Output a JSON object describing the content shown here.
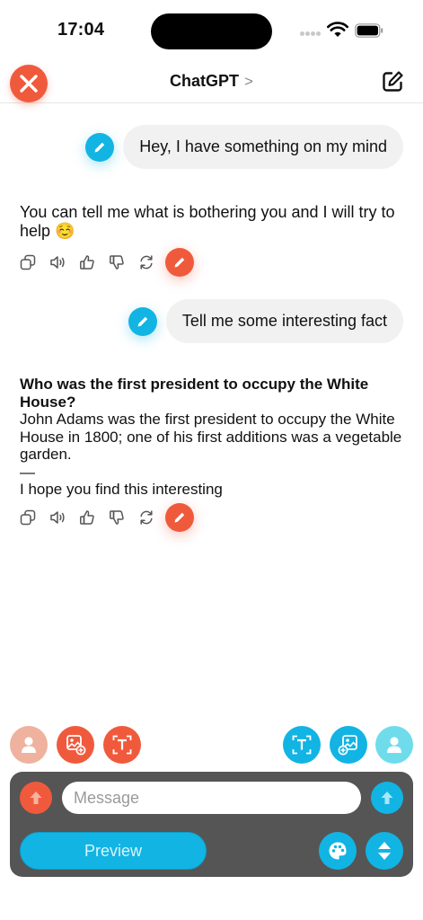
{
  "status_bar": {
    "time": "17:04"
  },
  "header": {
    "title": "ChatGPT",
    "chevron": ">"
  },
  "conversation": [
    {
      "role": "user",
      "text": "Hey, I have something on my mind"
    },
    {
      "role": "assistant",
      "text": "You can tell me what is bothering you and I will try to help ☺️"
    },
    {
      "role": "user",
      "text": "Tell me some interesting fact"
    },
    {
      "role": "assistant",
      "question": "Who was the first president to occupy the White House?",
      "answer": "John Adams was the first president to occupy the White House in 1800; one of his first additions was a vegetable garden.",
      "separator": "—",
      "closing": "I hope you find this interesting"
    }
  ],
  "message_actions": [
    "copy-icon",
    "speaker-icon",
    "thumbs-up-icon",
    "thumbs-down-icon",
    "regenerate-icon",
    "pencil-icon"
  ],
  "composer": {
    "placeholder": "Message",
    "preview_label": "Preview"
  },
  "colors": {
    "accent_orange": "#f05a3c",
    "accent_blue": "#12b4e3",
    "composer_bg": "#555555",
    "bubble_bg": "#f1f1f1"
  }
}
